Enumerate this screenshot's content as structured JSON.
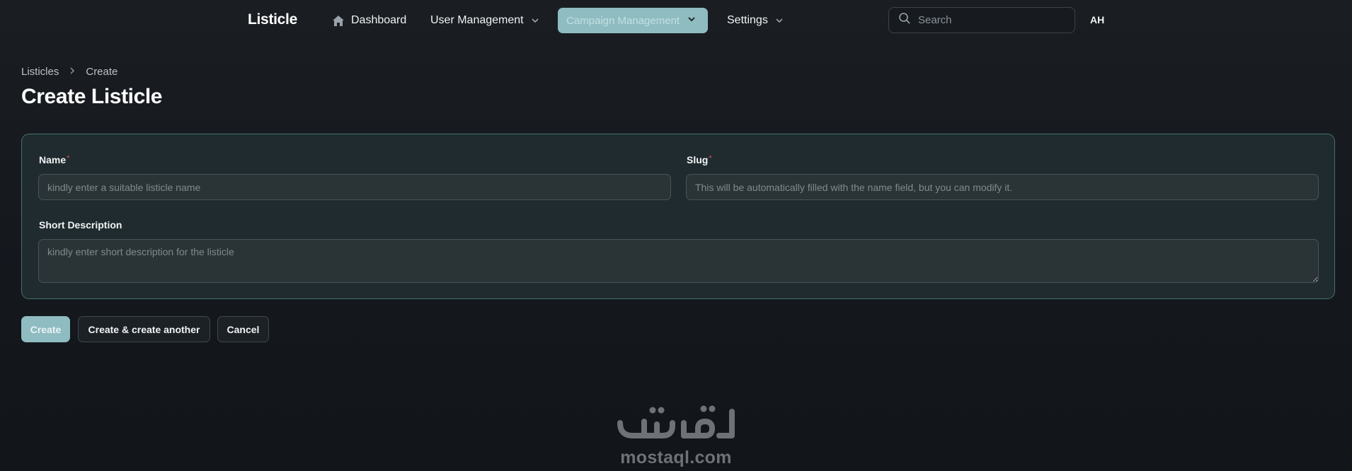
{
  "app": {
    "brand": "Listicle"
  },
  "nav": {
    "dashboard": "Dashboard",
    "user_management": "User Management",
    "campaign_management": "Campaign Management",
    "settings": "Settings"
  },
  "search": {
    "placeholder": "Search"
  },
  "user": {
    "initials": "AH"
  },
  "breadcrumb": {
    "items": [
      "Listicles",
      "Create"
    ]
  },
  "page": {
    "title": "Create Listicle"
  },
  "form": {
    "name": {
      "label": "Name",
      "required_mark": "*",
      "value": "",
      "placeholder": "kindly enter a suitable listicle name"
    },
    "slug": {
      "label": "Slug",
      "required_mark": "*",
      "value": "",
      "placeholder": "This will be automatically filled with the name field, but you can modify it."
    },
    "short_description": {
      "label": "Short Description",
      "value": "",
      "placeholder": "kindly enter short description for the listicle"
    }
  },
  "actions": {
    "create": "Create",
    "create_another": "Create & create another",
    "cancel": "Cancel"
  },
  "watermark": {
    "text": "mostaql.com"
  },
  "colors": {
    "accent": "#8fbcc1",
    "card_border": "#44716f",
    "required": "#d9534f",
    "background": "#14181d"
  }
}
